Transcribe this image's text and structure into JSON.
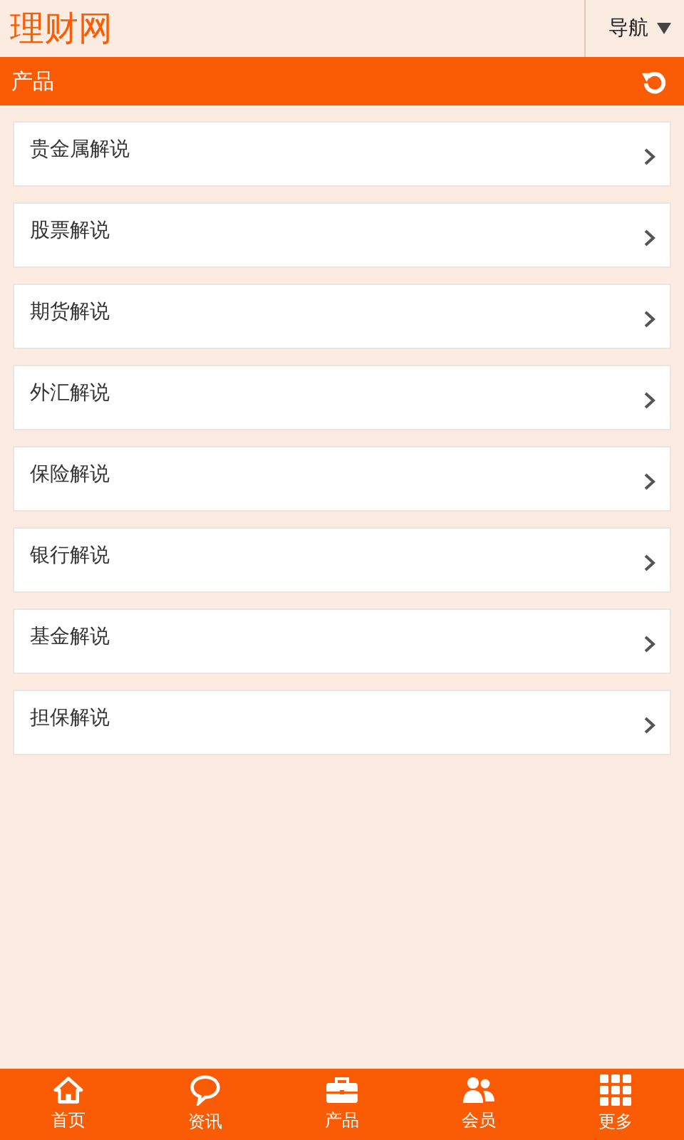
{
  "header": {
    "logo": "理财网",
    "nav_button": "导航"
  },
  "title_bar": {
    "title": "产品"
  },
  "items": [
    {
      "label": "贵金属解说"
    },
    {
      "label": "股票解说"
    },
    {
      "label": "期货解说"
    },
    {
      "label": "外汇解说"
    },
    {
      "label": "保险解说"
    },
    {
      "label": "银行解说"
    },
    {
      "label": "基金解说"
    },
    {
      "label": "担保解说"
    }
  ],
  "bottom_nav": [
    {
      "kind": "home",
      "label": "首页"
    },
    {
      "kind": "chat",
      "label": "资讯"
    },
    {
      "kind": "case",
      "label": "产品"
    },
    {
      "kind": "users",
      "label": "会员"
    },
    {
      "kind": "grid",
      "label": "更多"
    }
  ]
}
